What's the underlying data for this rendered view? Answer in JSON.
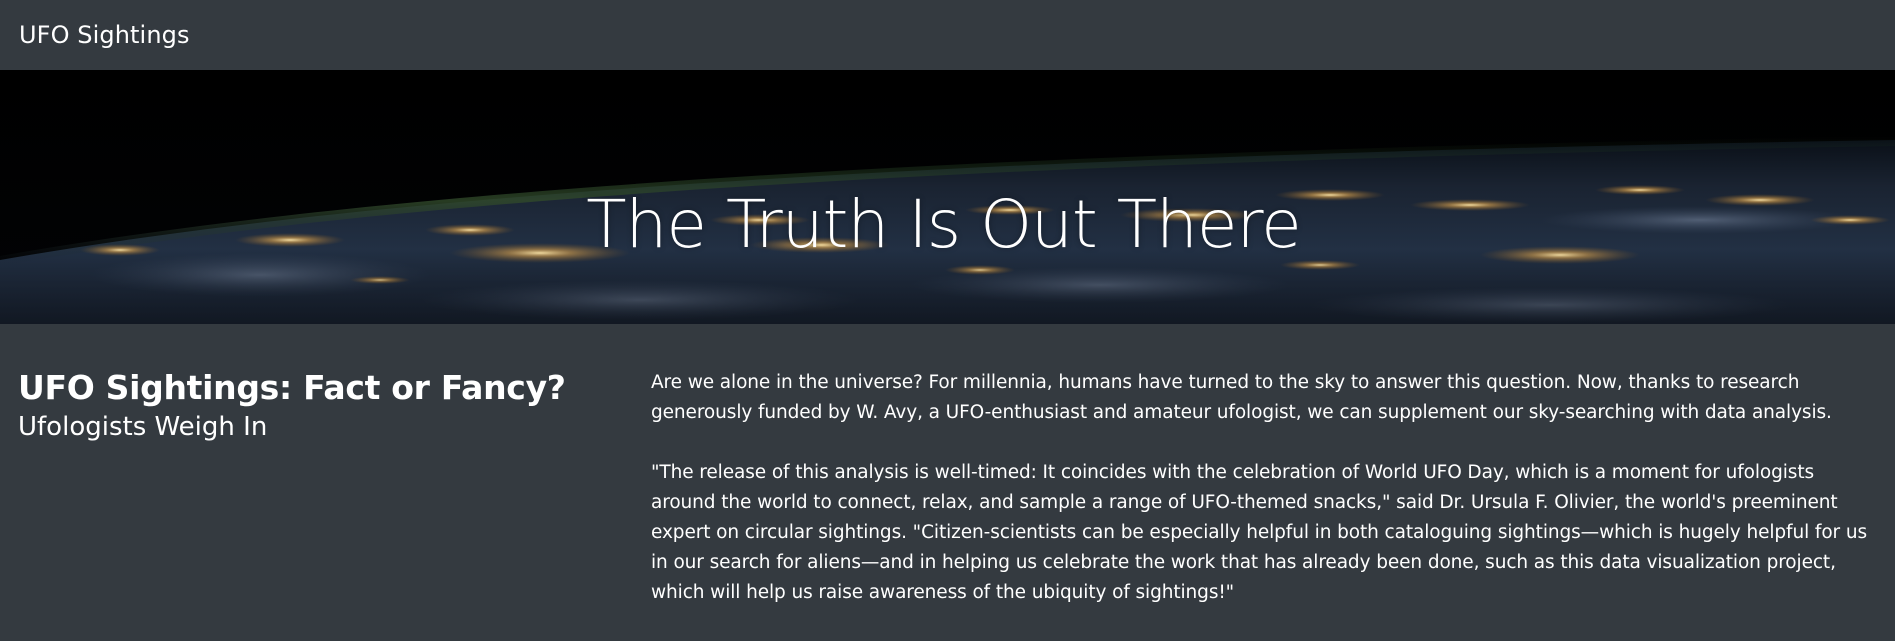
{
  "navbar": {
    "brand": "UFO Sightings"
  },
  "hero": {
    "title": "The Truth Is Out There"
  },
  "intro": {
    "heading": "UFO Sightings: Fact or Fancy?",
    "subheading": "Ufologists Weigh In"
  },
  "article": {
    "paragraphs": [
      "Are we alone in the universe? For millennia, humans have turned to the sky to answer this question. Now, thanks to research generously funded by W. Avy, a UFO-enthusiast and amateur ufologist, we can supplement our sky-searching with data analysis.",
      "\"The release of this analysis is well-timed: It coincides with the celebration of World UFO Day, which is a moment for ufologists around the world to connect, relax, and sample a range of UFO-themed snacks,\" said Dr. Ursula F. Olivier, the world's preeminent expert on circular sightings. \"Citizen-scientists can be especially helpful in both cataloguing sightings—which is hugely helpful for us in our search for aliens—and in helping us celebrate the work that has already been done, such as this data visualization project, which will help us raise awareness of the ubiquity of sightings!\""
    ]
  },
  "colors": {
    "page_background": "#343a40",
    "text": "#ffffff"
  }
}
